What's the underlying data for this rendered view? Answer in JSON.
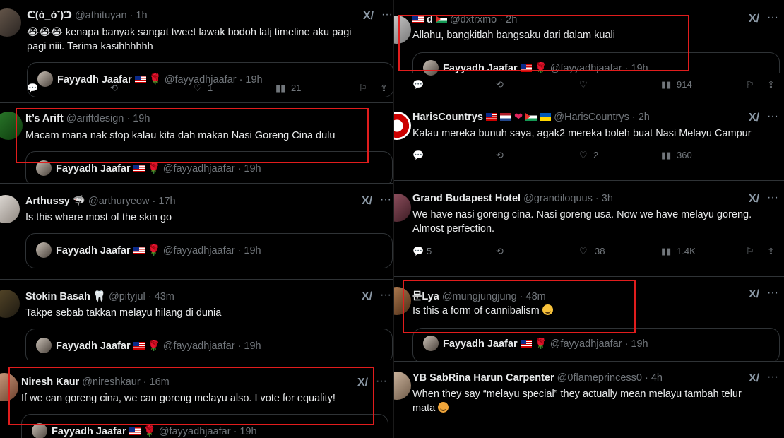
{
  "left": {
    "tweets": [
      {
        "name": "ᕦ(ò_óˇ)ᕤ",
        "handle": "@athituyan",
        "time": "· 1h",
        "text_line1": "kenapa banyak sangat tweet lawak bodoh lalj timeline aku pagi",
        "text_line2": "pagi niii. Terima kasihhhhhh",
        "emoji": "😭😭😭",
        "quote_name": "Fayyadh Jaafar",
        "quote_handle": "@fayyadhjaafar",
        "quote_time": "· 19h",
        "likes": "1",
        "views": "21"
      },
      {
        "name": "It’s Arift",
        "handle": "@ariftdesign",
        "time": "· 19h",
        "text_line1": "Macam mana nak stop kalau kita dah makan Nasi Goreng Cina dulu",
        "quote_name": "Fayyadh Jaafar",
        "quote_handle": "@fayyadhjaafar",
        "quote_time": "· 19h"
      },
      {
        "name": "Arthussy",
        "handle": "@arthuryeow",
        "time": "· 17h",
        "text_line1": "Is this where most of the skin go",
        "quote_name": "Fayyadh Jaafar",
        "quote_handle": "@fayyadhjaafar",
        "quote_time": "· 19h"
      },
      {
        "name": "Stokin Basah",
        "handle": "@pityjul",
        "time": "· 43m",
        "text_line1": "Takpe sebab takkan melayu hilang di dunia",
        "quote_name": "Fayyadh Jaafar",
        "quote_handle": "@fayyadhjaafar",
        "quote_time": "· 19h"
      },
      {
        "name": "Niresh Kaur",
        "handle": "@nireshkaur",
        "time": "· 16m",
        "text_line1": "If we can goreng cina, we can goreng melayu also. I vote for equality!",
        "quote_name": "Fayyadh Jaafar",
        "quote_handle": "@fayyadhjaafar",
        "quote_time": "· 19h"
      }
    ]
  },
  "right": {
    "tweets": [
      {
        "name": "d",
        "handle": "@dxtrxmo",
        "time": "· 2h",
        "text_line1": "Allahu, bangkitlah bangsaku dari dalam kuali",
        "quote_name": "Fayyadh Jaafar",
        "quote_handle": "@fayyadhjaafar",
        "quote_time": "· 19h",
        "views": "914"
      },
      {
        "name": "HarisCountrys",
        "handle": "@HarisCountrys",
        "time": "· 2h",
        "text_line1": "Kalau mereka bunuh saya, agak2 mereka boleh buat Nasi Melayu Campur",
        "likes": "2",
        "views": "360"
      },
      {
        "name": "Grand Budapest Hotel",
        "handle": "@grandiloquus",
        "time": "· 3h",
        "text_line1": "We have nasi goreng cina. Nasi goreng usa. Now we have melayu goreng.",
        "text_line2": "Almost perfection.",
        "replies": "5",
        "likes": "38",
        "views": "1.4K"
      },
      {
        "name": "문Lya",
        "handle": "@mungjungjung",
        "time": "· 48m",
        "text_line1": "Is this a form of cannibalism",
        "quote_name": "Fayyadh Jaafar",
        "quote_handle": "@fayyadhjaafar",
        "quote_time": "· 19h"
      },
      {
        "name": "YB SabRina Harun Carpenter",
        "handle": "@0flameprincess0",
        "time": "· 4h",
        "text_line1": "When they say “melayu special” they actually mean melayu tambah telur",
        "text_line2": "mata"
      }
    ]
  },
  "icons": {
    "grok": "grok-icon",
    "more": "more-icon",
    "reply": "reply-icon",
    "retweet": "retweet-icon",
    "like": "heart-icon",
    "views": "views-icon",
    "bookmark": "bookmark-icon",
    "share": "share-icon"
  },
  "colors": {
    "highlight_box": "#e11d1d",
    "background": "#000000",
    "muted_text": "#71767b"
  }
}
